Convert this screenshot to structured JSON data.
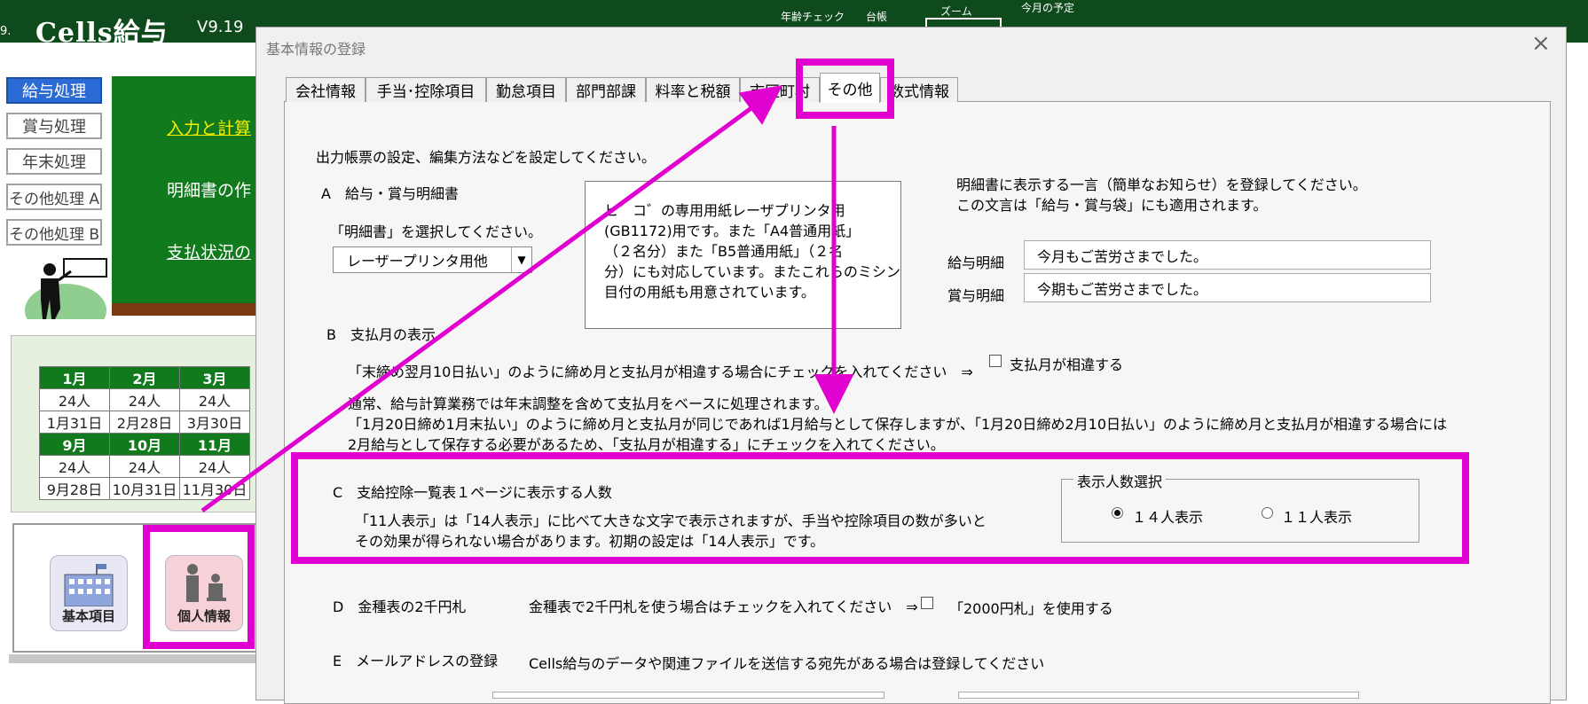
{
  "app": {
    "edge": "9.",
    "title": "Cells給与",
    "version": "V9.19",
    "toolbar": {
      "age_check": "年齢チェック",
      "ledger": "台帳",
      "zoom": "ズーム",
      "schedule": "今月の予定"
    },
    "sidebar": [
      {
        "label": "給与処理",
        "active": true
      },
      {
        "label": "賞与処理",
        "active": false
      },
      {
        "label": "年末処理",
        "active": false
      },
      {
        "label": "その他処理 A",
        "active": false
      },
      {
        "label": "その他処理 B",
        "active": false
      }
    ],
    "links": {
      "input_calc": "入力と計算",
      "statement_create": "明細書の作",
      "payment_status": "支払状況の"
    },
    "calendar": {
      "rows": [
        [
          "1月",
          "2月",
          "3月"
        ],
        [
          "24人",
          "24人",
          "24人"
        ],
        [
          "1月31日",
          "2月28日",
          "3月30日"
        ],
        [
          "9月",
          "10月",
          "11月"
        ],
        [
          "24人",
          "24人",
          "24人"
        ],
        [
          "9月28日",
          "10月31日",
          "11月30日"
        ]
      ]
    },
    "bottom_buttons": {
      "basic_items": "基本項目",
      "personal_info": "個人情報"
    }
  },
  "dialog": {
    "title": "基本情報の登録",
    "close": "×",
    "tabs": [
      "会社情報",
      "手当･控除項目",
      "勤怠項目",
      "部門部課",
      "料率と税額",
      "市区町村",
      "その他",
      "数式情報"
    ],
    "selected_tab": "その他",
    "intro": "出力帳票の設定、編集方法などを設定してください。",
    "section_a": {
      "heading": "A　給与・賞与明細書",
      "prompt": "「明細書」を選択してください。",
      "dropdown_value": "レーザープリンタ用他",
      "description": [
        "ヒ゛コ゛の専用用紙レーザプリンタ用",
        "(GB1172)用です。また「A4普通用紙」",
        "（２名分）また「B5普通用紙」（２名",
        "分）にも対応しています。またこれらのミシン",
        "目付の用紙も用意されています。"
      ],
      "message_note": [
        "明細書に表示する一言（簡単なお知らせ）を登録してください。",
        "この文言は「給与・賞与袋」にも適用されます。"
      ],
      "salary_label": "給与明細",
      "salary_message": "今月もご苦労さまでした。",
      "bonus_label": "賞与明細",
      "bonus_message": "今期もご苦労さまでした。"
    },
    "section_b": {
      "heading": "B　支払月の表示",
      "check_prompt": "「末締め翌月10日払い」のように締め月と支払月が相違する場合にチェックを入れてください　⇒",
      "checkbox_label": "支払月が相違する",
      "checked": false,
      "explain": [
        "通常、給与計算業務では年末調整を含めて支払月をベースに処理されます。",
        "「1月20日締め1月末払い」のように締め月と支払月が同じであれば1月給与として保存しますが、「1月20日締め2月10日払い」のように締め月と支払月が相違する場合には",
        "2月給与として保存する必要があるため、「支払月が相違する」にチェックを入れてください。"
      ]
    },
    "section_c": {
      "heading": "C　支給控除一覧表１ページに表示する人数",
      "explain": [
        "「11人表示」は「14人表示」に比べて大きな文字で表示されますが、手当や控除項目の数が多いと",
        "その効果が得られない場合があります。初期の設定は「14人表示」です。"
      ],
      "group_label": "表示人数選択",
      "options": [
        {
          "label": "１４人表示",
          "selected": true
        },
        {
          "label": "１１人表示",
          "selected": false
        }
      ]
    },
    "section_d": {
      "heading": "D　金種表の2千円札",
      "prompt": "金種表で2千円札を使う場合はチェックを入れてください　⇒",
      "checkbox_label": "「2000円札」を使用する",
      "checked": false
    },
    "section_e": {
      "heading": "E　メールアドレスの登録",
      "prompt": "Cells給与のデータや関連ファイルを送信する宛先がある場合は登録してください"
    }
  },
  "annotation": {
    "color": "#e000d0"
  }
}
